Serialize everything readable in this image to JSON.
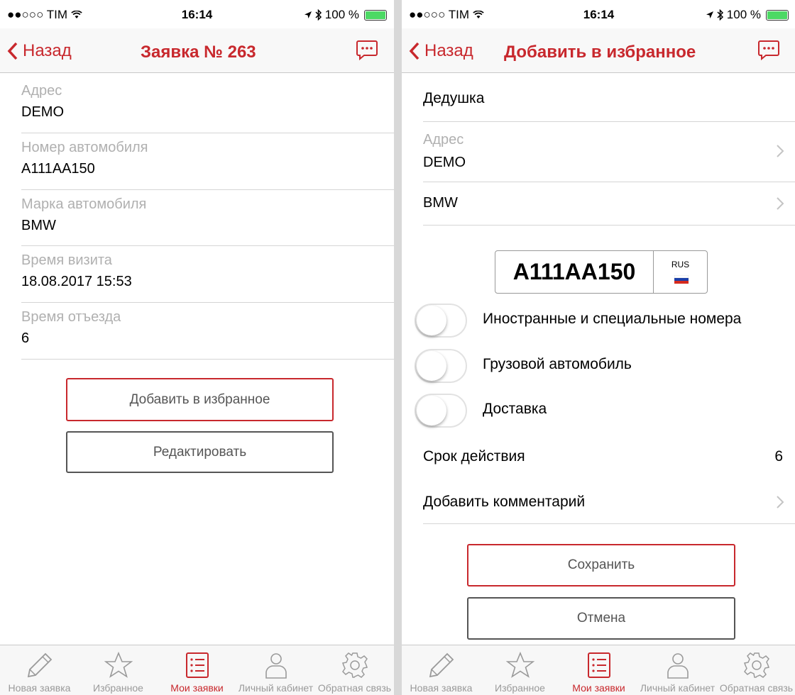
{
  "status": {
    "signal": "●●○○○ TIM",
    "wifi": "wifi-icon",
    "time": "16:14",
    "battery_text": "100 %",
    "battery_icon": "battery-icon"
  },
  "colors": {
    "accent": "#c8282d",
    "switch_off": "#ffffff",
    "battery": "#4cd964"
  },
  "left": {
    "back_label": "Назад",
    "title": "Заявка № 263",
    "fields": [
      {
        "label": "Адрес",
        "value": "DEMO"
      },
      {
        "label": "Номер автомобиля",
        "value": "А111АА150"
      },
      {
        "label": "Марка автомобиля",
        "value": "BMW"
      },
      {
        "label": "Время визита",
        "value": "18.08.2017 15:53"
      },
      {
        "label": "Время отъезда",
        "value": "6"
      }
    ],
    "buttons": {
      "favorite": "Добавить в избранное",
      "edit": "Редактировать"
    }
  },
  "right": {
    "back_label": "Назад",
    "title": "Добавить в избранное",
    "name": "Дедушка",
    "address_label": "Адрес",
    "address_value": "DEMO",
    "brand": "BMW",
    "plate": {
      "number": "А111АА150",
      "region": "RUS"
    },
    "toggles": [
      {
        "label": "Иностранные и специальные номера",
        "on": false
      },
      {
        "label": "Грузовой автомобиль",
        "on": false
      },
      {
        "label": "Доставка",
        "on": false
      }
    ],
    "validity_label": "Срок действия",
    "validity_value": "6",
    "comment_label": "Добавить комментарий",
    "buttons": {
      "save": "Сохранить",
      "cancel": "Отмена"
    }
  },
  "tabs": [
    {
      "label": "Новая заявка",
      "icon": "pencil-icon",
      "active": false
    },
    {
      "label": "Избранное",
      "icon": "star-icon",
      "active": false
    },
    {
      "label": "Мои заявки",
      "icon": "list-icon",
      "active": true
    },
    {
      "label": "Личный кабинет",
      "icon": "person-icon",
      "active": false
    },
    {
      "label": "Обратная связь",
      "icon": "gear-icon",
      "active": false
    }
  ]
}
